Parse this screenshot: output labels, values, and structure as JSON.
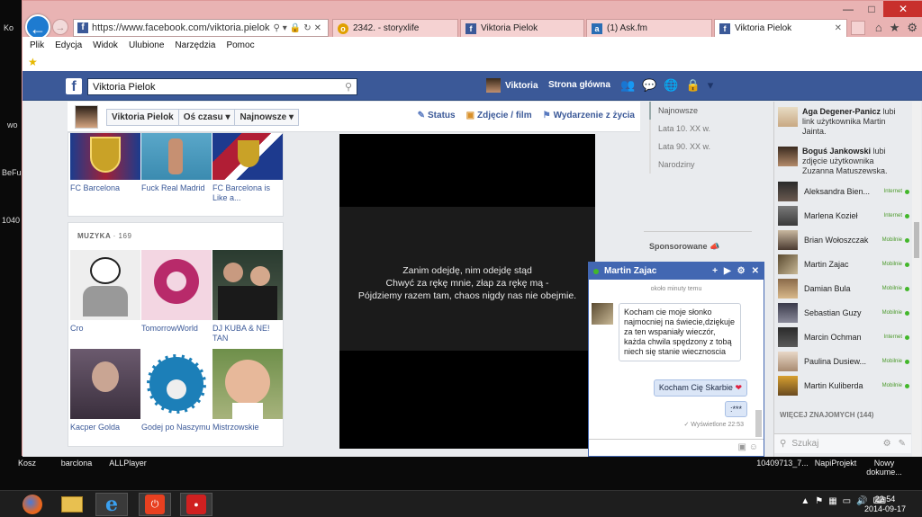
{
  "desktop": {
    "left_labels": [
      "Ko",
      "wo",
      "BeFu",
      "1040"
    ],
    "bottom_labels": [
      "Kosz",
      "barclona",
      "ALLPlayer",
      "10409713_7...",
      "NapiProjekt",
      "Nowy dokume..."
    ]
  },
  "browser": {
    "url": "https://www.facebook.com/viktoria.pielok",
    "tabs": [
      {
        "label": "2342. - storyxlife",
        "icon": "story-favicon"
      },
      {
        "label": "Viktoria Pielok",
        "icon": "facebook-favicon"
      },
      {
        "label": "(1) Ask.fm",
        "icon": "askfm-favicon"
      },
      {
        "label": "Viktoria Pielok",
        "icon": "facebook-favicon"
      }
    ],
    "menu": [
      "Plik",
      "Edycja",
      "Widok",
      "Ulubione",
      "Narzędzia",
      "Pomoc"
    ]
  },
  "fb": {
    "search_value": "Viktoria Pielok",
    "user_name": "Viktoria",
    "home_label": "Strona główna"
  },
  "timeline": {
    "name": "Viktoria Pielok",
    "time_select": "Oś czasu",
    "sort_select": "Najnowsze",
    "actions": {
      "status": "Status",
      "photo": "Zdjęcie / film",
      "event": "Wydarzenie z życia"
    }
  },
  "likes_row": [
    {
      "caption": "FC Barcelona"
    },
    {
      "caption": "Fuck Real Madrid"
    },
    {
      "caption": "FC Barcelona is Like a..."
    }
  ],
  "music": {
    "title": "MUZYKA",
    "count": "· 169",
    "items": [
      {
        "caption": "Cro"
      },
      {
        "caption": "TomorrowWorld"
      },
      {
        "caption": "DJ KUBA & NE! TAN"
      },
      {
        "caption": "Kacper Golda"
      },
      {
        "caption": "Godej po Naszymu"
      },
      {
        "caption": "Mistrzowskie"
      }
    ]
  },
  "photo": {
    "quote_lines": [
      "Zanim odejdę, nim odejdę stąd",
      "Chwyć za rękę mnie, złap za rękę mą -",
      "Pójdziemy razem tam, chaos nigdy nas nie obejmie."
    ]
  },
  "scrubber": [
    "Najnowsze",
    "Lata 10. XX w.",
    "Lata 90. XX w.",
    "Narodziny"
  ],
  "sponsored": "Sponsorowane",
  "ticker": [
    {
      "name": "Aga Degener-Panicz",
      "text": " lubi link użytkownika Martin Jainta."
    },
    {
      "name": "Boguś Jankowski",
      "text": " lubi zdjęcie użytkownika Zuzanna Matuszewska."
    }
  ],
  "contacts": [
    {
      "name": "Aleksandra Bien...",
      "status": "Internet"
    },
    {
      "name": "Marlena Kozieł",
      "status": "Internet"
    },
    {
      "name": "Brian Wołoszczak",
      "status": "Mobilnie"
    },
    {
      "name": "Martin Zajac",
      "status": "Mobilnie"
    },
    {
      "name": "Damian Bula",
      "status": "Mobilnie"
    },
    {
      "name": "Sebastian Guzy",
      "status": "Mobilnie"
    },
    {
      "name": "Marcin Ochman",
      "status": "Internet"
    },
    {
      "name": "Paulina Dusiew...",
      "status": "Mobilnie"
    },
    {
      "name": "Martin Kuliberda",
      "status": "Mobilnie"
    }
  ],
  "more_friends": "WIĘCEJ ZNAJOMYCH (144)",
  "sidebar_search_placeholder": "Szukaj",
  "chat": {
    "name": "Martin Zajac",
    "time": "około minuty temu",
    "incoming": "Kocham cie moje słonko najmocniej na świecie,dziękuje za ten wspaniały wieczór, każda chwila spędzony z tobą niech się stanie wiecznoscia",
    "outgoing_1": "Kocham Cię Skarbie",
    "outgoing_2": ":***",
    "seen": "Wyświetlone 22:53"
  },
  "taskbar": {
    "time": "22:54",
    "date": "2014-09-17"
  }
}
